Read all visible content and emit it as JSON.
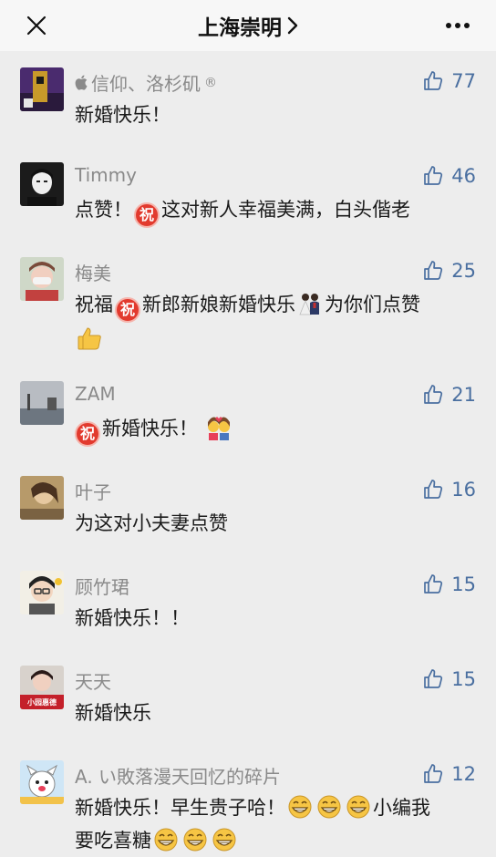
{
  "header": {
    "title": "上海崇明",
    "chevron": "›"
  },
  "comments": [
    {
      "name": "信仰、洛杉矶",
      "apple_prefix": true,
      "name_suffix": "®",
      "text": "新婚快乐！",
      "likes": "77"
    },
    {
      "name": "Timmy",
      "text_a": "点赞！",
      "text_b": "这对新人幸福美满，白头偕老",
      "likes": "46"
    },
    {
      "name": "梅美",
      "text_a": "祝福",
      "text_b": "新郎新娘新婚快乐",
      "text_c": "为你们点赞",
      "likes": "25"
    },
    {
      "name": "ZAM",
      "text": "新婚快乐！",
      "likes": "21"
    },
    {
      "name": "叶子",
      "text": "为这对小夫妻点赞",
      "likes": "16"
    },
    {
      "name": "顾竹珺",
      "text": "新婚快乐！！",
      "likes": "15"
    },
    {
      "name": "天天",
      "text": "新婚快乐",
      "avatar_caption": "小园惠德",
      "likes": "15"
    },
    {
      "name": "A. い敗落漫天回忆的碎片",
      "text_a": "新婚快乐！早生贵子哈！",
      "text_b": "小编我",
      "text_c": "要吃喜糖",
      "likes": "12"
    }
  ],
  "badge_char": "祝",
  "icons": [
    "close-icon",
    "chevron-right-icon",
    "more-icon",
    "thumb-up-icon",
    "apple-icon",
    "zhu-badge-icon",
    "thumbs-up-emoji",
    "couple-emoji",
    "kissing-couple-emoji",
    "grin-emoji"
  ]
}
